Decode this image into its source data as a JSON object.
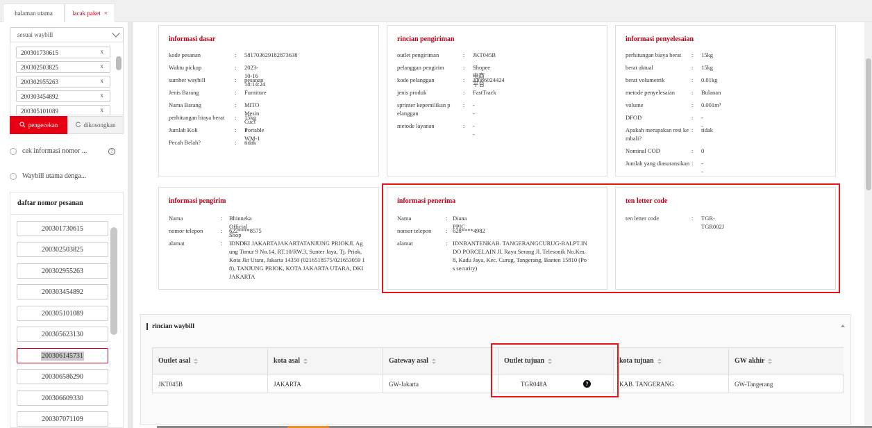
{
  "tabs": [
    {
      "label": "halaman utama"
    },
    {
      "label": "lacak paket",
      "close": "×"
    }
  ],
  "sidebar": {
    "select_value": "sesuai waybill",
    "waybills": [
      "200301730615",
      "200302503825",
      "200302955263",
      "200303454892",
      "200305101089"
    ],
    "remove_glyph": "x",
    "search_button": "pengecekan",
    "clear_button": "dikosongkan",
    "radio1": "cek informasi nomor ...",
    "radio2": "Waybill utama denga...",
    "help_glyph": "?",
    "order_list_title": "daftar nomor pesanan",
    "orders": [
      "200301730615",
      "200302503825",
      "200302955263",
      "200303454892",
      "200305101089",
      "200305623130",
      "200306145731",
      "200306586290",
      "200306609330",
      "200307071109"
    ],
    "selected_order": "200306145731"
  },
  "basic": {
    "title": "informasi dasar",
    "rows": [
      {
        "k": "kode pesanan",
        "v": "581703629182873638"
      },
      {
        "k": "Waktu pickup",
        "v": "2023-10-16 18:14:24"
      },
      {
        "k": "sumber waybill",
        "v": "pesanan"
      },
      {
        "k": "Jenis Barang",
        "v": "Furniture"
      },
      {
        "k": "Nama Barang",
        "v": "MITO Mesin Cuci Portable WM-1"
      },
      {
        "k": "perhitungan biaya berat",
        "v": "15kg"
      },
      {
        "k": "Jumlah Koli",
        "v": "1"
      },
      {
        "k": "Pecah Belah?",
        "v": "tidak"
      }
    ]
  },
  "shipping": {
    "title": "rincian pengiriman",
    "rows": [
      {
        "k": "outlet pengiriman",
        "v": "JKT045B"
      },
      {
        "k": "pelanggan pengirim",
        "v": "Shopee电商平台"
      },
      {
        "k": "kode pelanggan",
        "v": "J0086024424"
      },
      {
        "k": "jenis produk",
        "v": "FastTrack"
      },
      {
        "k": "sprinter kepemilikan p\nelanggan",
        "v": "--"
      },
      {
        "k": "metode layanan",
        "v": "--"
      }
    ]
  },
  "settlement": {
    "title": "informasi penyelesaian",
    "rows": [
      {
        "k": "perhitungan biaya berat",
        "v": "15kg"
      },
      {
        "k": "berat aktual",
        "v": "15kg"
      },
      {
        "k": "berat volumetrik",
        "v": "0.01kg"
      },
      {
        "k": "metode penyelesaian",
        "v": "Bulanan"
      },
      {
        "k": "volume",
        "v": "0.001m³"
      },
      {
        "k": "DFOD",
        "v": "--"
      },
      {
        "k": "Apakah merupakan resi ke\nmbali?",
        "v": "tidak"
      },
      {
        "k": "Nominal COD",
        "v": "0"
      },
      {
        "k": "Jumlah yang diasuransikan",
        "v": "--"
      }
    ]
  },
  "sender": {
    "title": "informasi pengirim",
    "rows": [
      {
        "k": "Nama",
        "v": "Bhinneka Official Shop"
      },
      {
        "k": "nomor telepon",
        "v": "622****8575"
      },
      {
        "k": "alamat",
        "v": "IDNDKI JAKARTAJAKARTATANJUNG PRIOKJl. Ag\nung Timur 9 No.14, RT.10/RW.3, Sunter Jaya, Tj. Priok,\nKota Jkt Utara, Jakarta 14350 (0216518575/021653059 1\n8), TANJUNG PRIOK, KOTA JAKARTA UTARA, DKI\nJAKARTA"
      }
    ]
  },
  "receiver": {
    "title": "informasi penerima",
    "rows": [
      {
        "k": "Nama",
        "v": "Diana PPIC"
      },
      {
        "k": "nomor telepon",
        "v": "628****4982"
      },
      {
        "k": "alamat",
        "v": "IDNBANTENKAB. TANGERANGCURUG-BALPT.IN\nDO PORCELAIN Jl. Raya Serang Jl. Telesonik No.Km.\n8, Kadu Jaya, Kec. Curug, Tangerang, Banten 15810 (Po\ns security)"
      }
    ]
  },
  "tlc": {
    "title": "ten letter code",
    "rows": [
      {
        "k": "ten letter code",
        "v": "TGR-TGR002J"
      }
    ]
  },
  "waybill_detail": {
    "title": "rincian waybill",
    "columns": [
      "Outlet asal",
      "kota asal",
      "Gateway asal",
      "Outlet tujuan",
      "kota tujuan",
      "GW akhir"
    ],
    "row": [
      "JKT045B",
      "JAKARTA",
      "GW-Jakarta",
      "TGR048A",
      "KAB. TANGERANG",
      "GW-Tangerang"
    ],
    "help_glyph": "?"
  },
  "colors": {
    "accent": "#e60012",
    "highlight_box": "#e01818"
  }
}
